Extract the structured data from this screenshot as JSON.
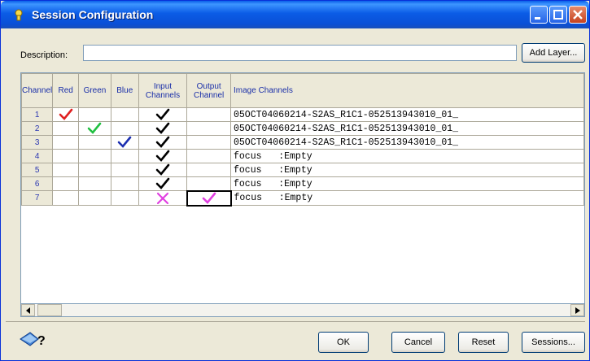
{
  "window": {
    "title": "Session Configuration"
  },
  "description": {
    "label": "Description:",
    "value": "",
    "add_layer_label": "Add Layer..."
  },
  "grid": {
    "headers": {
      "channel": "Channel",
      "red": "Red",
      "green": "Green",
      "blue": "Blue",
      "input_line1": "Input",
      "input_line2": "Channels",
      "output_line1": "Output",
      "output_line2": "Channel",
      "image": "Image Channels"
    },
    "rows": [
      {
        "channel": "1",
        "red": true,
        "green": false,
        "blue": false,
        "input": "check",
        "output": false,
        "image": "05OCT04060214-S2AS_R1C1-052513943010_01_"
      },
      {
        "channel": "2",
        "red": false,
        "green": true,
        "blue": false,
        "input": "check",
        "output": false,
        "image": "05OCT04060214-S2AS_R1C1-052513943010_01_"
      },
      {
        "channel": "3",
        "red": false,
        "green": false,
        "blue": true,
        "input": "check",
        "output": false,
        "image": "05OCT04060214-S2AS_R1C1-052513943010_01_"
      },
      {
        "channel": "4",
        "red": false,
        "green": false,
        "blue": false,
        "input": "check",
        "output": false,
        "image": "focus   :Empty"
      },
      {
        "channel": "5",
        "red": false,
        "green": false,
        "blue": false,
        "input": "check",
        "output": false,
        "image": "focus   :Empty"
      },
      {
        "channel": "6",
        "red": false,
        "green": false,
        "blue": false,
        "input": "check",
        "output": false,
        "image": "focus   :Empty"
      },
      {
        "channel": "7",
        "red": false,
        "green": false,
        "blue": false,
        "input": "cross",
        "output": true,
        "image": "focus   :Empty"
      }
    ]
  },
  "buttons": {
    "ok": "OK",
    "cancel": "Cancel",
    "reset": "Reset",
    "sessions": "Sessions..."
  },
  "colors": {
    "red_check": "#e02020",
    "green_check": "#20c040",
    "blue_check": "#1c2fb0",
    "input_check": "#000000",
    "magenta_mark": "#e040e0",
    "title_bar": "#0a5fe8"
  },
  "icons": {
    "title": "session-gear-icon",
    "help": "help-context-icon"
  }
}
